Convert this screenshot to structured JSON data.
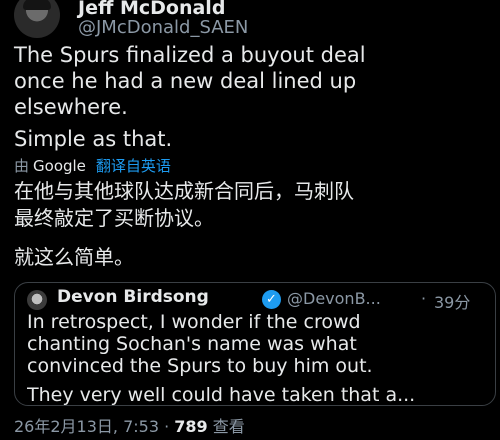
{
  "author": {
    "name": "Jeff McDonald",
    "handle": "@JMcDonald_SAEN"
  },
  "tweet": {
    "text_en": "The Spurs finalized a buyout deal\nonce he had a new deal lined up\nelsewhere.",
    "text_en_2": "Simple as that.",
    "translate": {
      "by": "由",
      "provider": "Google",
      "link": "翻译自英语"
    },
    "text_zh": "在他与其他球队达成新合同后，马刺队\n最终敲定了买断协议。",
    "text_zh_2": "就这么简单。"
  },
  "quote": {
    "name": "Devon Birdsong",
    "handle": "@DevonB...",
    "dot": "·",
    "time": "39分",
    "text": "In retrospect, I wonder if the crowd\nchanting Sochan's name was what\nconvinced the Spurs to buy him out.",
    "text_2": "They very well could have taken that a..."
  },
  "footer": {
    "timestamp": "26年2月13日, 7:53 · ",
    "views": "789",
    "views_label": "查看"
  },
  "colors": {
    "background": "#000000",
    "text": "#e7e9ea",
    "secondary": "#8b98a5",
    "link": "#1d9bf0",
    "verified": "#1d9bf0"
  }
}
